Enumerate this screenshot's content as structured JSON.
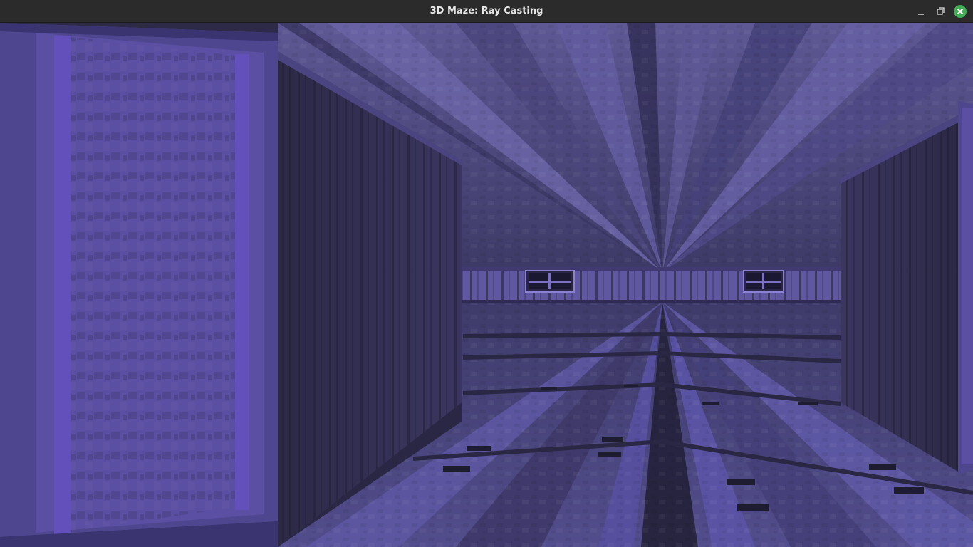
{
  "window": {
    "title": "3D Maze: Ray Casting",
    "controls": {
      "minimize_icon": "minimize-icon",
      "maximize_icon": "maximize-icon",
      "close_icon": "close-icon"
    }
  },
  "palette": {
    "ceiling": "#5a5590",
    "floor": "#4c4880",
    "wall_light": "#574d98",
    "wall_dark": "#2d2a4a",
    "stripe_bright": "#6550b0",
    "close_button": "#3fae57"
  }
}
